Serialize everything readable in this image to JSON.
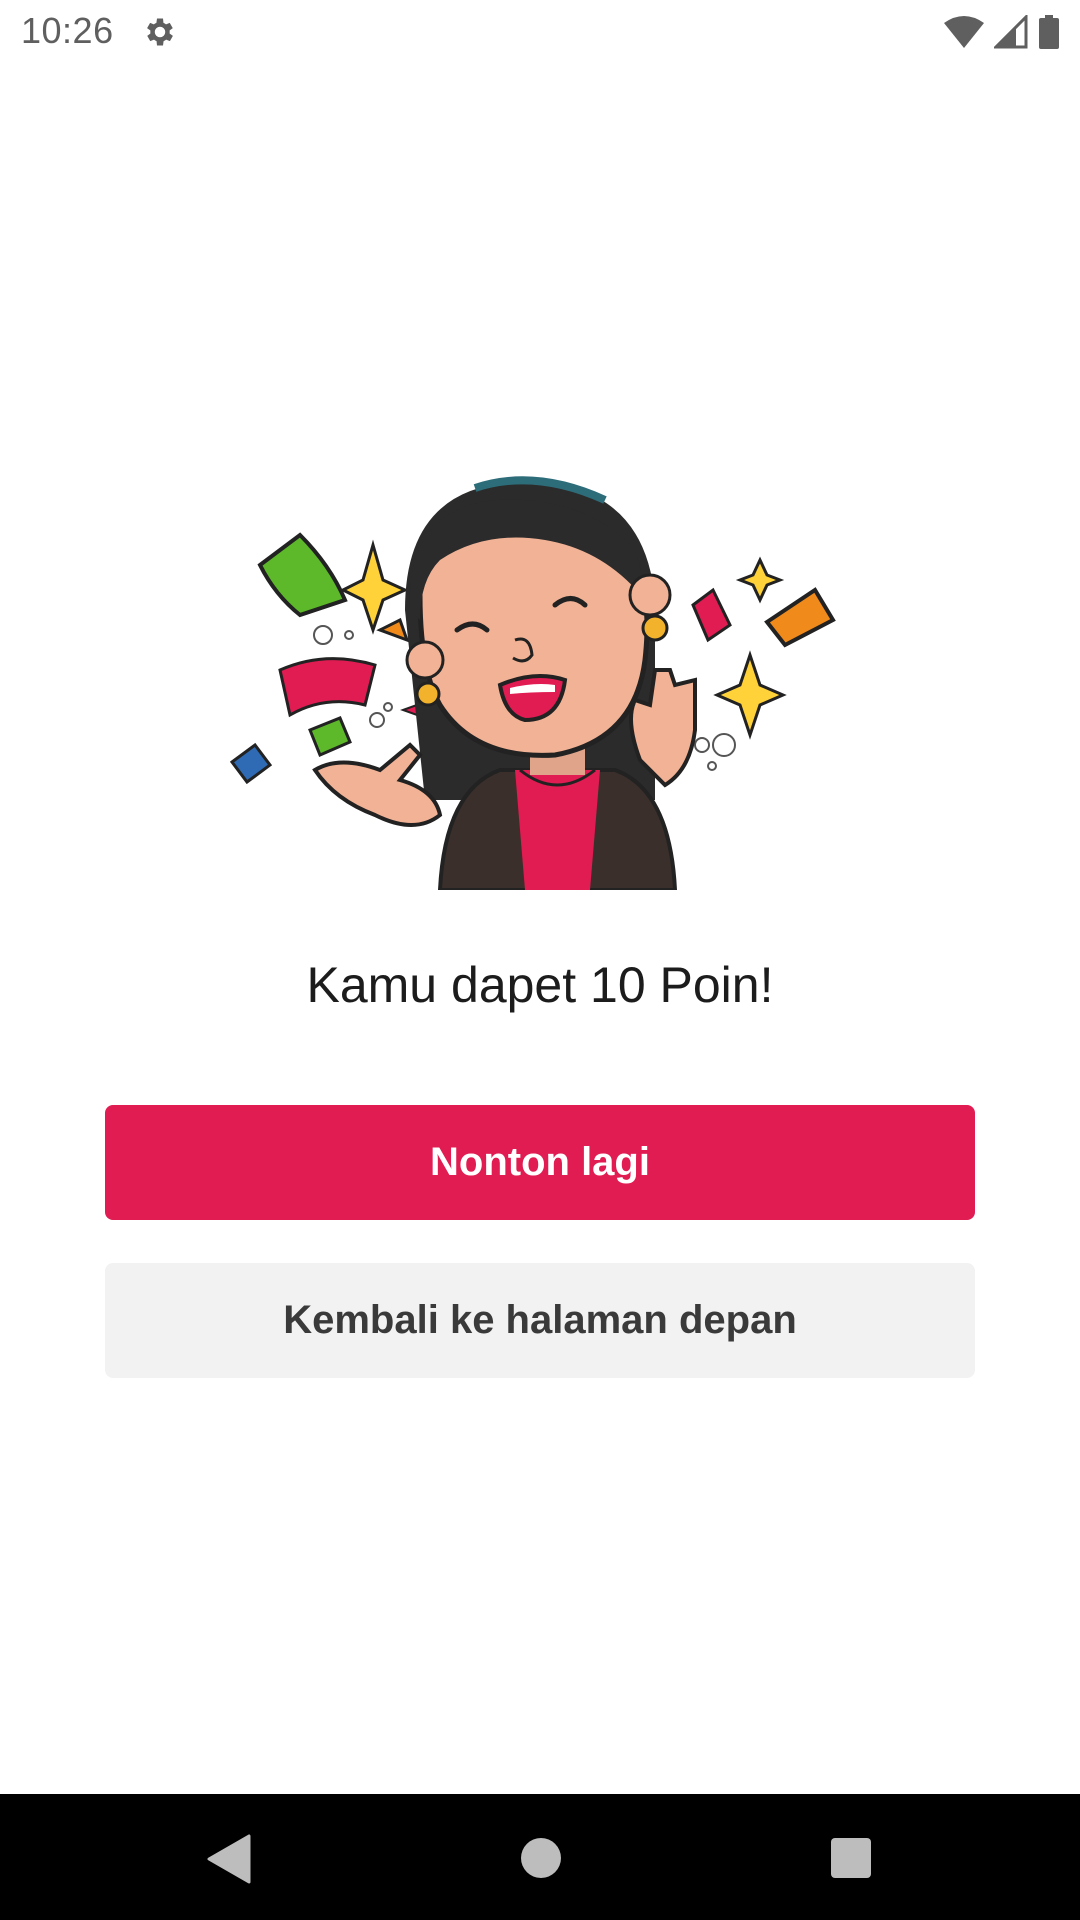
{
  "status_bar": {
    "time": "10:26",
    "icons": [
      "gear-icon",
      "wifi-icon",
      "signal-icon",
      "battery-icon"
    ]
  },
  "illustration": {
    "icon": "celebrating-woman-illustration"
  },
  "reward": {
    "message": "Kamu dapet 10 Poin!"
  },
  "actions": {
    "primary_label": "Nonton lagi",
    "secondary_label": "Kembali ke halaman depan"
  },
  "colors": {
    "accent": "#e01c52",
    "secondary_bg": "#f2f2f2",
    "nav_bar": "#000000"
  },
  "nav_bar": {
    "icons": [
      "back-icon",
      "home-icon",
      "recents-icon"
    ]
  }
}
